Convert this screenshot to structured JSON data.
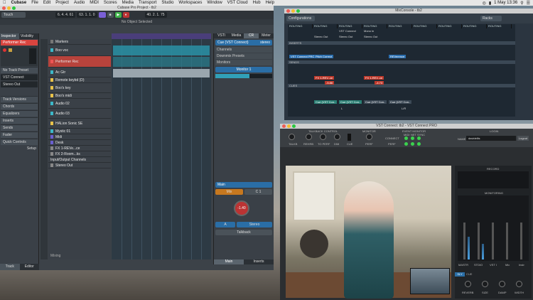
{
  "menubar": {
    "apple": "",
    "app": "Cubase",
    "items": [
      "File",
      "Edit",
      "Project",
      "Audio",
      "MIDI",
      "Scores",
      "Media",
      "Transport",
      "Studio",
      "Workspaces",
      "Window",
      "VST Cloud",
      "Hub",
      "Help"
    ],
    "clock": "1 May 13:36"
  },
  "cubase": {
    "title": "Cubase Pro Project - tb2",
    "mode": "Touch",
    "position": "6. 4. 4. 61",
    "position2": "63. 1. 1. 0",
    "position3": "40. 2. 1. 75",
    "info": "No Object Selected",
    "inspector_tabs": [
      "Inspector",
      "Visibility"
    ],
    "selected_track": "Performer Rec",
    "input": "No Track Preset",
    "routing_in": "VST Connect",
    "routing_out": "Stereo Out",
    "inspector_sections": [
      "Track Versions",
      "Chords",
      "Equalizers",
      "Inserts",
      "Sends",
      "Fader",
      "Quick Controls"
    ],
    "setup": "Setup",
    "bottom_tabs": [
      "Track",
      "Editor"
    ],
    "tracks": [
      "Markers",
      "Boo voc",
      "Performer Rec",
      "Ac Gtr",
      "Remote keybd (D)",
      "Boo's key",
      "Boo's midi",
      "Audio 02",
      "Audio 03",
      "HALion Sonic SE",
      "Mystic 01",
      "Midi",
      "Desk",
      "FX 1-REVe...ce",
      "FX 2-Room...ks",
      "Input/Output Channels",
      "Stereo Out"
    ],
    "vsti_tabs": [
      "VSTi",
      "Media",
      "CR",
      "Meter"
    ],
    "cue": "Cue (VST Connect)",
    "stereo": "stereo",
    "vsti_sections": [
      "Channels",
      "Downmix Presets",
      "Monitors"
    ],
    "monitor": "Monitor 1",
    "main": "Main",
    "mix_label": "Mix",
    "c1": "C 1",
    "gain": "-1.40",
    "a_label": "A",
    "stereo_btn": "Stereo",
    "talkback": "Talkback",
    "vsti_bottom": [
      "Main",
      "Inserts"
    ],
    "mixing": "Mixing"
  },
  "mix": {
    "title": "MixConsole - tb2",
    "configurations": "Configurations",
    "racks": "Racks",
    "headers": [
      "ROUTING",
      "ROUTING",
      "ROUTING",
      "ROUTING",
      "ROUTING",
      "ROUTING",
      "ROUTING",
      "ROUTING",
      "ROUTING"
    ],
    "routing_vals": [
      "VST Connect",
      "Mono in",
      "Stereo Out",
      "Stereo Out",
      "Stereo Out"
    ],
    "inserts": "INSERTS",
    "insert_vals": [
      "VST Connect PRO",
      "Pitch Correct",
      "REVerence"
    ],
    "sends": "SENDS",
    "send_vals": [
      "FX 1-REV..ce",
      "FX 1-REV..ce"
    ],
    "send_db": [
      "-5.86",
      "-4.73"
    ],
    "cues": "CUES",
    "cue_vals": [
      "Cue (VST Con..",
      "Cue (VST Con..",
      "Cue (VST Con..",
      "Cue (VST Con.."
    ],
    "l_label": "L",
    "lr_label": "L/R"
  },
  "vc": {
    "title": "VST Connect: tb2 - VST Connect PRO",
    "talkback_control": "TALKBACK CONTROL",
    "tb_labels": [
      "TALKB",
      "REHRB",
      "TO PERF",
      "DIM",
      "CUE"
    ],
    "monitor": "MONITOR",
    "perf": "PERF",
    "event_monitor": "EVENT MONITOR",
    "event_cols": [
      "MIDI",
      "NET",
      "SYNC"
    ],
    "connect": "CONNECT",
    "perf_row": "PERF",
    "login": "LOGIN",
    "name_label": "NAME",
    "name_val": "davidellis",
    "logout": "Logout",
    "record": "RECORD",
    "monitoring": "MONITORING",
    "channels": [
      "MASTR",
      "STDIO",
      "VST I",
      "Mic",
      "Instr"
    ],
    "bottom": [
      "SLY",
      "CUE"
    ],
    "fx_knobs": [
      "REVERB",
      "SIZE",
      "DAMP",
      "WIDTH"
    ]
  }
}
